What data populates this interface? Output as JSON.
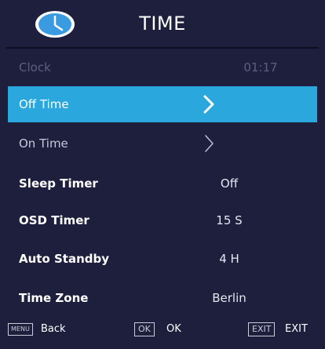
{
  "header": {
    "title": "TIME",
    "icon": "clock-icon"
  },
  "rows": [
    {
      "label": "Clock",
      "value": "01:17"
    },
    {
      "label": "Off Time",
      "value_icon": "chevron-right-icon"
    },
    {
      "label": "On Time",
      "value_icon": "chevron-right-icon"
    },
    {
      "label": "Sleep Timer",
      "value": "Off"
    },
    {
      "label": "OSD Timer",
      "value": "15 S"
    },
    {
      "label": "Auto Standby",
      "value": "4 H"
    },
    {
      "label": "Time Zone",
      "value": "Berlin"
    }
  ],
  "footer": {
    "menu_key": "MENU",
    "menu_label": "Back",
    "ok_key": "OK",
    "ok_label": "OK",
    "exit_key": "EXIT",
    "exit_label": "EXIT"
  },
  "colors": {
    "background": "#1d1f3d",
    "highlight": "#2aa7dd",
    "icon": "#3a9be0"
  }
}
